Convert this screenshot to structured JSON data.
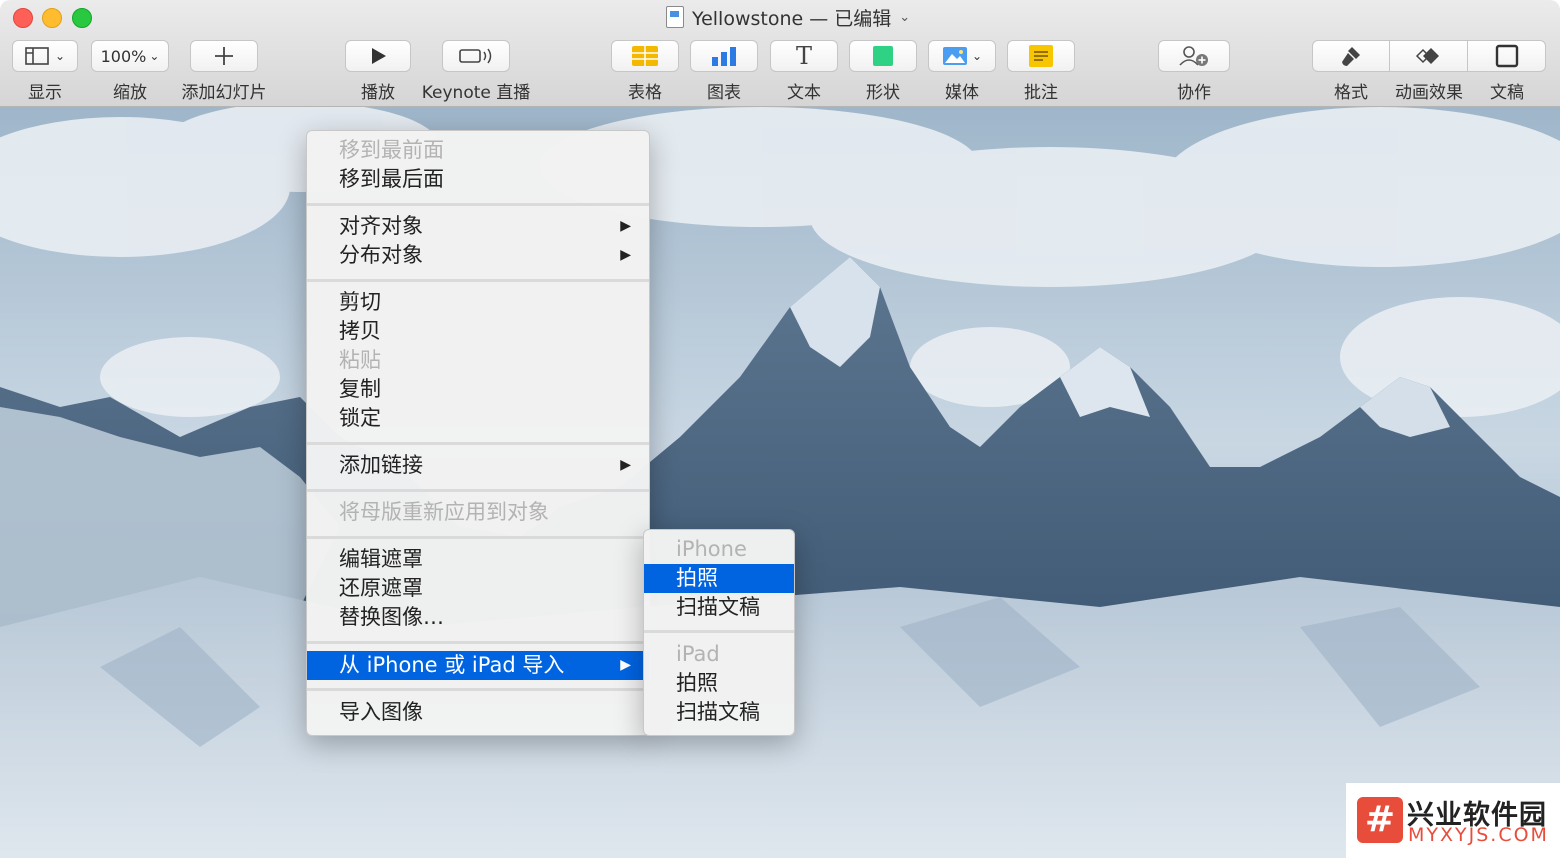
{
  "window": {
    "title": "Yellowstone — 已编辑"
  },
  "toolbar": {
    "view": {
      "label": "显示"
    },
    "zoom": {
      "value": "100%",
      "label": "缩放"
    },
    "add_slide": {
      "label": "添加幻灯片"
    },
    "play": {
      "label": "播放"
    },
    "keynote_live": {
      "label": "Keynote 直播"
    },
    "table": {
      "label": "表格"
    },
    "chart": {
      "label": "图表"
    },
    "text": {
      "label": "文本",
      "glyph": "T"
    },
    "shape": {
      "label": "形状"
    },
    "media": {
      "label": "媒体"
    },
    "comment": {
      "label": "批注"
    },
    "collaborate": {
      "label": "协作"
    },
    "format": {
      "label": "格式"
    },
    "animate": {
      "label": "动画效果"
    },
    "document": {
      "label": "文稿"
    }
  },
  "context_menu": {
    "items": [
      {
        "label": "移到最前面",
        "enabled": false
      },
      {
        "label": "移到最后面",
        "enabled": true
      },
      {
        "label": "对齐对象",
        "submenu": true
      },
      {
        "label": "分布对象",
        "submenu": true
      },
      {
        "label": "剪切",
        "enabled": true
      },
      {
        "label": "拷贝",
        "enabled": true
      },
      {
        "label": "粘贴",
        "enabled": false
      },
      {
        "label": "复制",
        "enabled": true
      },
      {
        "label": "锁定",
        "enabled": true
      },
      {
        "label": "添加链接",
        "submenu": true
      },
      {
        "label": "将母版重新应用到对象",
        "enabled": false
      },
      {
        "label": "编辑遮罩",
        "enabled": true
      },
      {
        "label": "还原遮罩",
        "enabled": true
      },
      {
        "label": "替换图像…",
        "enabled": true
      },
      {
        "label": "从 iPhone 或 iPad 导入",
        "submenu": true,
        "highlighted": true
      },
      {
        "label": "导入图像",
        "enabled": true
      }
    ]
  },
  "submenu": {
    "items": [
      {
        "label": "iPhone",
        "header": true
      },
      {
        "label": "拍照",
        "highlighted": true
      },
      {
        "label": "扫描文稿"
      },
      {
        "label": "iPad",
        "header": true
      },
      {
        "label": "拍照"
      },
      {
        "label": "扫描文稿"
      }
    ]
  },
  "watermark": {
    "cn": "兴业软件园",
    "en": "MYXYJS.COM",
    "logo": "#"
  },
  "colors": {
    "highlight": "#0064e1",
    "table_icon": "#f5b800",
    "chart_icon": "#2c7be5",
    "shape_icon": "#2fd184",
    "comment_icon": "#f7c600",
    "watermark_red": "#e84d3c"
  }
}
